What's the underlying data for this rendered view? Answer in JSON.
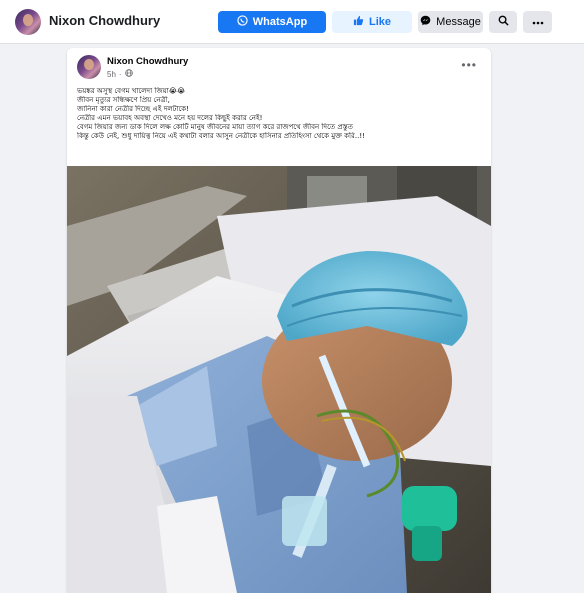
{
  "profile": {
    "name": "Nixon Chowdhury"
  },
  "actions": {
    "whatsapp_label": "WhatsApp",
    "like_label": "Like",
    "message_label": "Message"
  },
  "post": {
    "author": "Nixon Chowdhury",
    "time": "5h",
    "lines": [
      "ভয়ঙ্কর অসুস্থ বেগম খালেদা জিয়া😭😭",
      "জীবন মৃত্যুর সন্ধিক্ষণে প্রিয় নেত্রী,",
      "জানিনা কারা নেত্রীর দিচ্ছে এই দলটাকে!",
      "নেত্রীর এমন ভয়াবহ অবস্থা দেখেও মনে হয় দলের কিছুই করার নেই!",
      "বেগম জিয়ার জন্য ডাক দিলে লক্ষ কোটি মানুষ জীবনের মায়া ত্যাগ করে রাজপথে জীবন দিতে প্রস্তুত",
      "কিন্তু কেউ নেই, শুধু দায়িত্ব নিয়ে এই কথাটা বলার আসুন নেত্রীকে হাসিনার প্রতিহিংসা থেকে মুক্ত করি..!!"
    ]
  },
  "icons": {
    "whatsapp": "whatsapp-icon",
    "like": "thumbs-up-icon",
    "message": "messenger-icon",
    "search": "search-icon",
    "more": "more-icon",
    "audience": "globe-icon",
    "post_options": "ellipsis-icon"
  },
  "colors": {
    "brand_blue": "#1877f2",
    "like_bg": "#e7f3ff",
    "button_gray": "#e4e6eb",
    "page_bg": "#f0f2f5"
  }
}
